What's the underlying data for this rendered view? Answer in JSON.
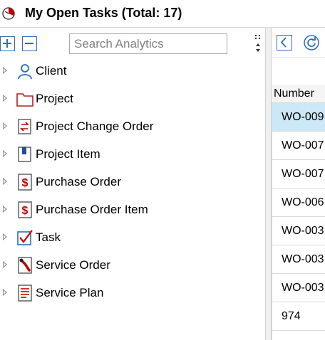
{
  "window": {
    "title": "My Open Tasks (Total: 17)"
  },
  "toolbar": {
    "expand_icon": "plus-box-icon",
    "collapse_icon": "minus-box-icon",
    "search_placeholder": "Search Analytics",
    "accent": "#2a6ebb"
  },
  "tree": {
    "items": [
      {
        "label": "Client",
        "icon": "person-icon"
      },
      {
        "label": "Project",
        "icon": "folder-icon"
      },
      {
        "label": "Project Change Order",
        "icon": "change-order-icon"
      },
      {
        "label": "Project Item",
        "icon": "project-item-icon"
      },
      {
        "label": "Purchase Order",
        "icon": "dollar-document-icon"
      },
      {
        "label": "Purchase Order Item",
        "icon": "dollar-document-icon"
      },
      {
        "label": "Task",
        "icon": "checkbox-icon"
      },
      {
        "label": "Service Order",
        "icon": "wrench-icon"
      },
      {
        "label": "Service Plan",
        "icon": "document-lines-icon"
      }
    ]
  },
  "grid": {
    "column_header": "Number",
    "rows": [
      "WO-009",
      "WO-007",
      "WO-007",
      "WO-006",
      "WO-003",
      "WO-003",
      "WO-003",
      "974"
    ],
    "selected_color": "#cce8f7"
  }
}
